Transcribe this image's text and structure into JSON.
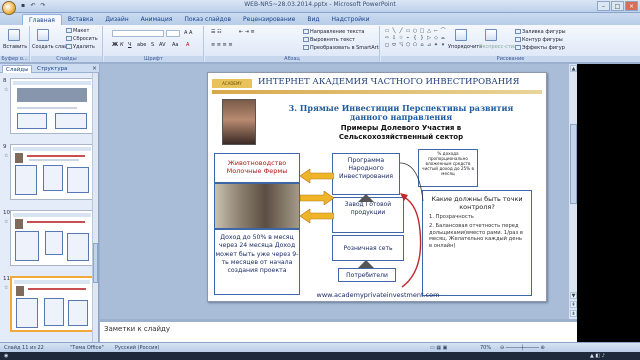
{
  "window": {
    "title": "WEB-NR5~28.03.2014.pptx - Microsoft PowerPoint"
  },
  "qat": {
    "save": "save-icon",
    "undo": "undo-icon",
    "redo": "redo-icon"
  },
  "tabs": [
    "Главная",
    "Вставка",
    "Дизайн",
    "Анимация",
    "Показ слайдов",
    "Рецензирование",
    "Вид",
    "Надстройки"
  ],
  "ribbon": {
    "clipboard": {
      "paste": "Вставить",
      "label": "Буфер о..."
    },
    "slides": {
      "new_slide": "Создать слайд",
      "layout": "Макет",
      "reset": "Сбросить",
      "delete": "Удалить",
      "label": "Слайды"
    },
    "font": {
      "label": "Шрифт"
    },
    "paragraph": {
      "dir": "Направление текста",
      "align": "Выровнять текст",
      "smartart": "Преобразовать в SmartArt",
      "label": "Абзац"
    },
    "drawing": {
      "arrange": "Упорядочить",
      "quick_styles": "Экспресс-стили",
      "fill": "Заливка фигуры",
      "outline": "Контур фигуры",
      "effects": "Эффекты фигур",
      "label": "Рисование"
    }
  },
  "left_panel": {
    "tabs": [
      "Слайды",
      "Структура"
    ],
    "close": "×",
    "slide_numbers": [
      "8",
      "9",
      "10",
      "11"
    ]
  },
  "slide": {
    "logo": "ACADEMY",
    "header": "ИНТЕРНЕТ АКАДЕМИЯ ЧАСТНОГО ИНВЕСТИРОВАНИЯ",
    "title": "3. Прямые Инвестиции Перспективы развития данного направления",
    "subtitle": "Примеры Долевого Участия в Сельскохозяйственный сектор",
    "animals_box": "Животноводство Молочные Фермы",
    "income_box": "Доход до 50% в месяц через 24 месяца Доход может быть уже через 9-ть месяцев от начала создания проекта",
    "program_box": "Программа Народного Инвестирования",
    "percent_box": "% дохода пропорционально вложенным средств чистый доход до 25% в месяц",
    "factory_box": "Завод Готовой продукции",
    "retail_box": "Розничная сеть",
    "consumers_box": "Потребители",
    "control_question": "Какие должны быть точки контроля?",
    "control_items": [
      "Прозрачность",
      "Балансовая отчетность перед дольщиками(вместо рами. 1/раз в месяц. Желательно каждый день в онлайн)"
    ],
    "url": "www.academyprivateinvestment.com"
  },
  "notes": {
    "placeholder": "Заметки к слайду"
  },
  "status": {
    "slide": "Слайд 11 из 22",
    "theme": "\"Тема Office\"",
    "lang": "Русский (Россия)",
    "zoom": "70%"
  },
  "colors": {
    "accent": "#1d5a9e",
    "header_text": "#1d3d7a",
    "box_border": "#3f66a8",
    "arrow": "#f0b429",
    "red": "#c0282a"
  }
}
